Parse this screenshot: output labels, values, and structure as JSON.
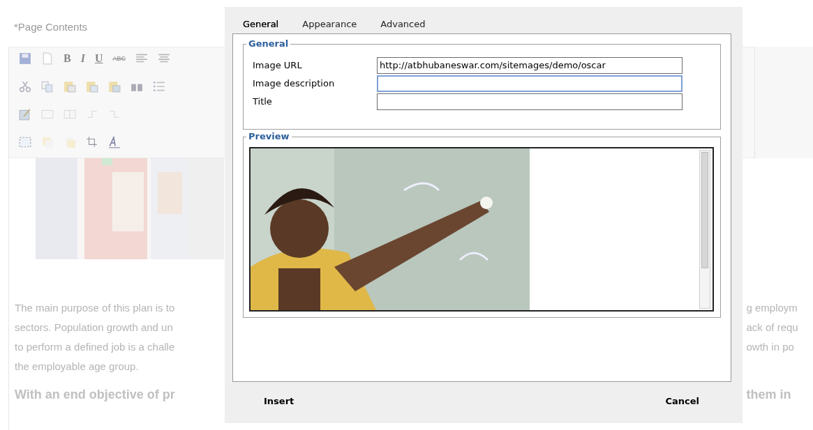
{
  "page": {
    "heading": "*Page Contents",
    "toolbar": {
      "glyphs": [
        "B",
        "I",
        "U",
        "ABC"
      ]
    },
    "paragraph_left": [
      "The main purpose of this plan is to",
      "sectors. Population growth and un",
      "to perform a defined job is a challe",
      "the employable age group."
    ],
    "paragraph_right": [
      "g employm",
      "ack of requ",
      "owth in po"
    ],
    "bold_left": "With an end objective of pr",
    "bold_right": "them in"
  },
  "dialog": {
    "tabs": [
      {
        "label": "General",
        "selected": true
      },
      {
        "label": "Appearance",
        "selected": false
      },
      {
        "label": "Advanced",
        "selected": false
      }
    ],
    "general": {
      "legend": "General",
      "fields": [
        {
          "label": "Image URL",
          "value": "http://atbhubaneswar.com/sitemages/demo/oscar",
          "focused": false
        },
        {
          "label": "Image description",
          "focused": true
        },
        {
          "label": "Title",
          "focused": false
        }
      ]
    },
    "preview": {
      "legend": "Preview"
    },
    "buttons": [
      {
        "label": "Insert"
      },
      {
        "label": "Cancel"
      }
    ]
  }
}
